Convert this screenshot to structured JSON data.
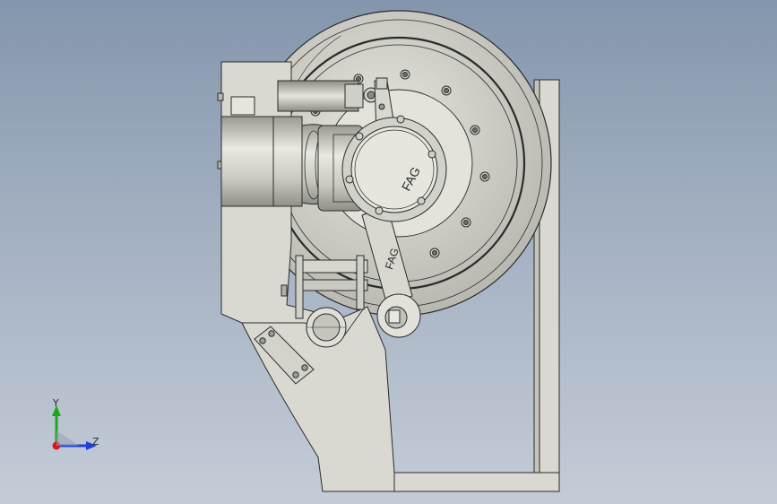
{
  "viewport": {
    "background_top": "#8496ad",
    "background_bottom": "#c4ccd7"
  },
  "model": {
    "part_color": "#d9d9d2",
    "edge_color": "#2b2b2b",
    "bearing_cover_label": "FAG",
    "arm_label": "FAG"
  },
  "triad": {
    "y_label": "Y",
    "z_label": "Z",
    "y_color": "#1aa81a",
    "z_color": "#2040d8",
    "x_color": "#d81a1a"
  }
}
